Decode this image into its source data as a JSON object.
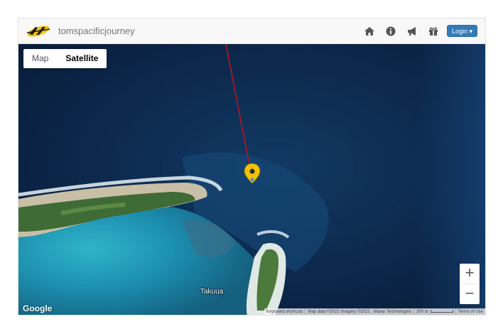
{
  "brand": {
    "name": "tomspacificjourney",
    "logo_icon": "flying-logo-icon",
    "accent": "#f5c400"
  },
  "nav": {
    "icons": [
      "home-icon",
      "info-icon",
      "megaphone-icon",
      "gift-icon"
    ],
    "login_label": "Login ▾",
    "login_color": "#337ab7"
  },
  "map": {
    "type_buttons": {
      "map": "Map",
      "satellite": "Satellite",
      "selected": "Satellite"
    },
    "zoom": {
      "in": "+",
      "out": "−"
    },
    "place_label": "Takuua",
    "google_logo": "Google",
    "marker_color": "#f2c200",
    "route_color": "#c0141e",
    "attribution": {
      "shortcuts": "Keyboard shortcuts",
      "data": "Map data ©2022 Imagery ©2022 , Maxar Technologies",
      "scale": "200 m",
      "terms": "Terms of Use"
    }
  }
}
